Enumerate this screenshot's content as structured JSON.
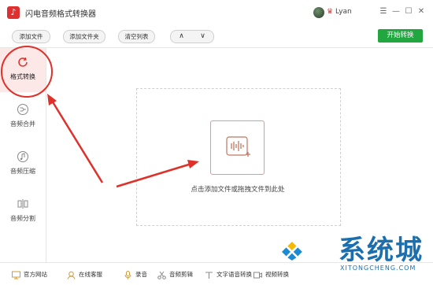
{
  "app": {
    "title": "闪电音频格式转换器",
    "user_name": "Lyan",
    "vip_icon": "crown-icon"
  },
  "window_controls": [
    "minimize-icon",
    "maximize-icon",
    "close-icon"
  ],
  "toolbar": {
    "add_file": "添加文件",
    "add_folder": "添加文件夹",
    "clear_list": "清空列表",
    "move_up": "∧",
    "move_down": "∨",
    "start": "开始转换"
  },
  "sidebar": {
    "items": [
      {
        "label": "格式转换",
        "icon": "refresh-icon",
        "active": true
      },
      {
        "label": "音频合并",
        "icon": "merge-icon",
        "active": false
      },
      {
        "label": "音频压缩",
        "icon": "compress-icon",
        "active": false
      },
      {
        "label": "音频分割",
        "icon": "split-icon",
        "active": false
      }
    ]
  },
  "dropzone": {
    "icon": "audio-add-icon",
    "hint": "点击添加文件或拖拽文件到此处"
  },
  "footer": {
    "items": [
      {
        "label": "官方网站",
        "icon": "monitor-icon"
      },
      {
        "label": "在线客服",
        "icon": "support-icon"
      },
      {
        "label": "录音",
        "icon": "mic-icon"
      },
      {
        "label": "音频剪辑",
        "icon": "scissors-icon"
      },
      {
        "label": "文字语音转换",
        "icon": "text-voice-icon"
      },
      {
        "label": "视频转换",
        "icon": "video-icon"
      }
    ]
  },
  "watermark": {
    "text": "系统城",
    "sub": "XITONGCHENG.COM"
  },
  "colors": {
    "accent_red": "#e0302a",
    "start_green": "#22a640",
    "active_bg": "#fde8e8",
    "watermark_blue": "#1c6fae"
  }
}
